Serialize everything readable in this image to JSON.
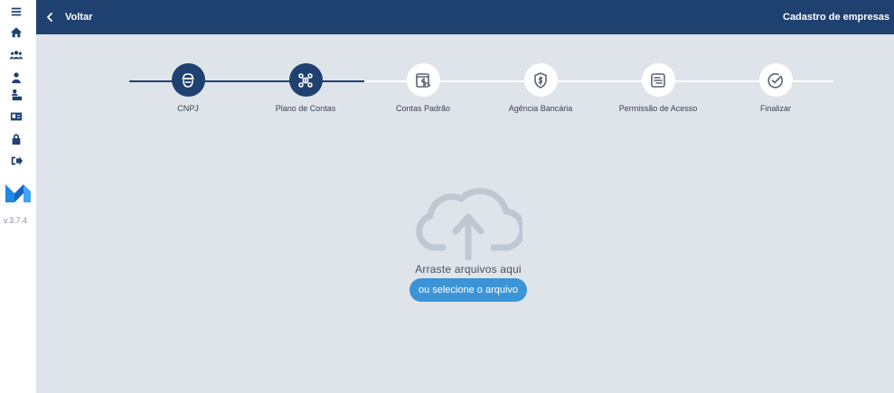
{
  "header": {
    "back_label": "Voltar",
    "title": "Cadastro de empresas",
    "color": "#1f4170"
  },
  "sidebar": {
    "icons": [
      "menu-icon",
      "home-icon",
      "users-icon",
      "user-icon",
      "user-keyboard-icon",
      "id-card-icon",
      "lock-icon",
      "logout-icon"
    ],
    "version": "v.3.7.4"
  },
  "stepper": {
    "steps": [
      {
        "label": "CNPJ",
        "icon": "building-icon",
        "active": true
      },
      {
        "label": "Plano de Contas",
        "icon": "network-icon",
        "active": true
      },
      {
        "label": "Contas Padrão",
        "icon": "money-document-icon",
        "active": false
      },
      {
        "label": "Agência Bancária",
        "icon": "shield-dollar-icon",
        "active": false
      },
      {
        "label": "Permissão de Acesso",
        "icon": "list-document-icon",
        "active": false
      },
      {
        "label": "Finalizar",
        "icon": "check-circle-icon",
        "active": false
      }
    ]
  },
  "upload": {
    "icon": "cloud-upload-icon",
    "drop_text": "Arraste arquivos aqui",
    "select_label": "ou selecione o arquivo"
  }
}
